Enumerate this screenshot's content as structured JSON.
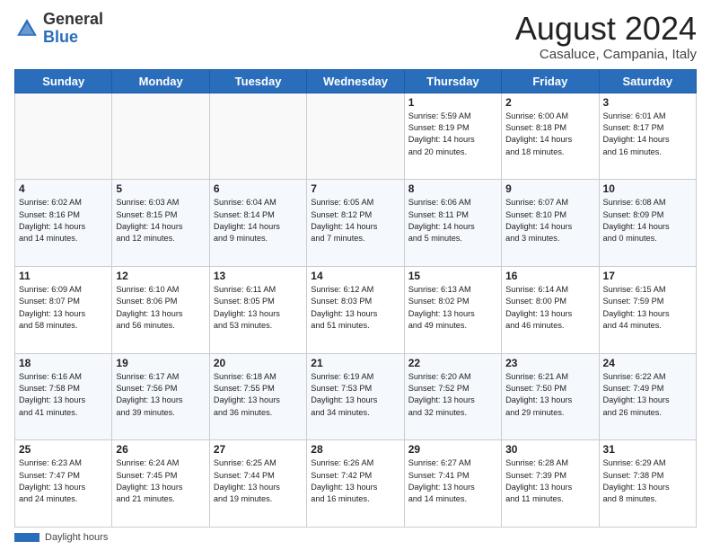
{
  "logo": {
    "general": "General",
    "blue": "Blue"
  },
  "header": {
    "month_year": "August 2024",
    "location": "Casaluce, Campania, Italy"
  },
  "days_of_week": [
    "Sunday",
    "Monday",
    "Tuesday",
    "Wednesday",
    "Thursday",
    "Friday",
    "Saturday"
  ],
  "footer": {
    "bar_label": "Daylight hours"
  },
  "weeks": [
    [
      {
        "day": "",
        "info": ""
      },
      {
        "day": "",
        "info": ""
      },
      {
        "day": "",
        "info": ""
      },
      {
        "day": "",
        "info": ""
      },
      {
        "day": "1",
        "info": "Sunrise: 5:59 AM\nSunset: 8:19 PM\nDaylight: 14 hours\nand 20 minutes."
      },
      {
        "day": "2",
        "info": "Sunrise: 6:00 AM\nSunset: 8:18 PM\nDaylight: 14 hours\nand 18 minutes."
      },
      {
        "day": "3",
        "info": "Sunrise: 6:01 AM\nSunset: 8:17 PM\nDaylight: 14 hours\nand 16 minutes."
      }
    ],
    [
      {
        "day": "4",
        "info": "Sunrise: 6:02 AM\nSunset: 8:16 PM\nDaylight: 14 hours\nand 14 minutes."
      },
      {
        "day": "5",
        "info": "Sunrise: 6:03 AM\nSunset: 8:15 PM\nDaylight: 14 hours\nand 12 minutes."
      },
      {
        "day": "6",
        "info": "Sunrise: 6:04 AM\nSunset: 8:14 PM\nDaylight: 14 hours\nand 9 minutes."
      },
      {
        "day": "7",
        "info": "Sunrise: 6:05 AM\nSunset: 8:12 PM\nDaylight: 14 hours\nand 7 minutes."
      },
      {
        "day": "8",
        "info": "Sunrise: 6:06 AM\nSunset: 8:11 PM\nDaylight: 14 hours\nand 5 minutes."
      },
      {
        "day": "9",
        "info": "Sunrise: 6:07 AM\nSunset: 8:10 PM\nDaylight: 14 hours\nand 3 minutes."
      },
      {
        "day": "10",
        "info": "Sunrise: 6:08 AM\nSunset: 8:09 PM\nDaylight: 14 hours\nand 0 minutes."
      }
    ],
    [
      {
        "day": "11",
        "info": "Sunrise: 6:09 AM\nSunset: 8:07 PM\nDaylight: 13 hours\nand 58 minutes."
      },
      {
        "day": "12",
        "info": "Sunrise: 6:10 AM\nSunset: 8:06 PM\nDaylight: 13 hours\nand 56 minutes."
      },
      {
        "day": "13",
        "info": "Sunrise: 6:11 AM\nSunset: 8:05 PM\nDaylight: 13 hours\nand 53 minutes."
      },
      {
        "day": "14",
        "info": "Sunrise: 6:12 AM\nSunset: 8:03 PM\nDaylight: 13 hours\nand 51 minutes."
      },
      {
        "day": "15",
        "info": "Sunrise: 6:13 AM\nSunset: 8:02 PM\nDaylight: 13 hours\nand 49 minutes."
      },
      {
        "day": "16",
        "info": "Sunrise: 6:14 AM\nSunset: 8:00 PM\nDaylight: 13 hours\nand 46 minutes."
      },
      {
        "day": "17",
        "info": "Sunrise: 6:15 AM\nSunset: 7:59 PM\nDaylight: 13 hours\nand 44 minutes."
      }
    ],
    [
      {
        "day": "18",
        "info": "Sunrise: 6:16 AM\nSunset: 7:58 PM\nDaylight: 13 hours\nand 41 minutes."
      },
      {
        "day": "19",
        "info": "Sunrise: 6:17 AM\nSunset: 7:56 PM\nDaylight: 13 hours\nand 39 minutes."
      },
      {
        "day": "20",
        "info": "Sunrise: 6:18 AM\nSunset: 7:55 PM\nDaylight: 13 hours\nand 36 minutes."
      },
      {
        "day": "21",
        "info": "Sunrise: 6:19 AM\nSunset: 7:53 PM\nDaylight: 13 hours\nand 34 minutes."
      },
      {
        "day": "22",
        "info": "Sunrise: 6:20 AM\nSunset: 7:52 PM\nDaylight: 13 hours\nand 32 minutes."
      },
      {
        "day": "23",
        "info": "Sunrise: 6:21 AM\nSunset: 7:50 PM\nDaylight: 13 hours\nand 29 minutes."
      },
      {
        "day": "24",
        "info": "Sunrise: 6:22 AM\nSunset: 7:49 PM\nDaylight: 13 hours\nand 26 minutes."
      }
    ],
    [
      {
        "day": "25",
        "info": "Sunrise: 6:23 AM\nSunset: 7:47 PM\nDaylight: 13 hours\nand 24 minutes."
      },
      {
        "day": "26",
        "info": "Sunrise: 6:24 AM\nSunset: 7:45 PM\nDaylight: 13 hours\nand 21 minutes."
      },
      {
        "day": "27",
        "info": "Sunrise: 6:25 AM\nSunset: 7:44 PM\nDaylight: 13 hours\nand 19 minutes."
      },
      {
        "day": "28",
        "info": "Sunrise: 6:26 AM\nSunset: 7:42 PM\nDaylight: 13 hours\nand 16 minutes."
      },
      {
        "day": "29",
        "info": "Sunrise: 6:27 AM\nSunset: 7:41 PM\nDaylight: 13 hours\nand 14 minutes."
      },
      {
        "day": "30",
        "info": "Sunrise: 6:28 AM\nSunset: 7:39 PM\nDaylight: 13 hours\nand 11 minutes."
      },
      {
        "day": "31",
        "info": "Sunrise: 6:29 AM\nSunset: 7:38 PM\nDaylight: 13 hours\nand 8 minutes."
      }
    ]
  ]
}
